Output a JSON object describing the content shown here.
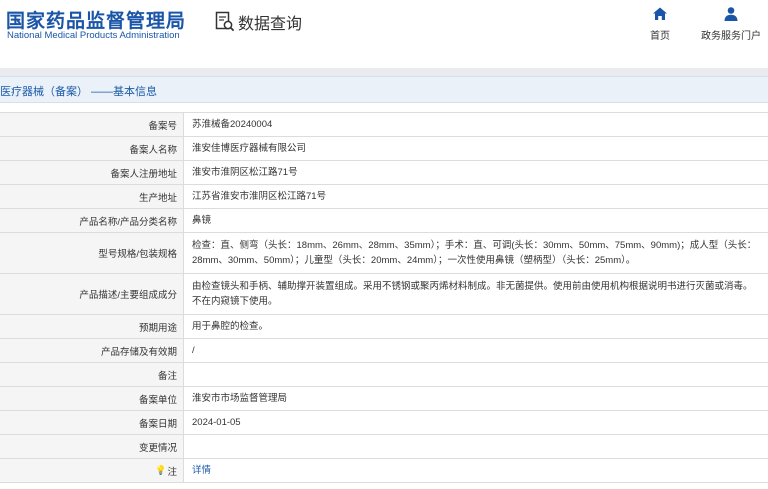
{
  "header": {
    "logo_cn": "国家药品监督管理局",
    "logo_en": "National Medical Products Administration",
    "query_title": "数据查询",
    "nav": [
      {
        "label": "首页",
        "icon": "home-icon"
      },
      {
        "label": "政务服务门户",
        "icon": "user-icon"
      }
    ]
  },
  "section": {
    "title": "医疗器械（备案） ——基本信息"
  },
  "rows": [
    {
      "label": "备案号",
      "value": "苏淮械备20240004"
    },
    {
      "label": "备案人名称",
      "value": "淮安佳博医疗器械有限公司"
    },
    {
      "label": "备案人注册地址",
      "value": "淮安市淮阴区松江路71号"
    },
    {
      "label": "生产地址",
      "value": "江苏省淮安市淮阴区松江路71号"
    },
    {
      "label": "产品名称/产品分类名称",
      "value": "鼻镜"
    },
    {
      "label": "型号规格/包装规格",
      "value": "检查：直、侧弯（头长：18mm、26mm、28mm、35mm）；手术：直、可调(头长：30mm、50mm、75mm、90mm)；成人型（头长：28mm、30mm、50mm）；儿童型（头长：20mm、24mm）；一次性使用鼻镜（塑柄型）（头长：25mm）。"
    },
    {
      "label": "产品描述/主要组成成分",
      "value": "由检查镜头和手柄、辅助撑开装置组成。采用不锈钢或聚丙烯材料制成。非无菌提供。使用前由使用机构根据说明书进行灭菌或消毒。不在内窥镜下使用。"
    },
    {
      "label": "预期用途",
      "value": "用于鼻腔的检查。"
    },
    {
      "label": "产品存储及有效期",
      "value": "/"
    },
    {
      "label": "备注",
      "value": ""
    },
    {
      "label": "备案单位",
      "value": "淮安市市场监督管理局"
    },
    {
      "label": "备案日期",
      "value": "2024-01-05"
    },
    {
      "label": "变更情况",
      "value": ""
    },
    {
      "label": "注",
      "value": "详情"
    }
  ],
  "colors": {
    "brand": "#1a55a8",
    "section_bg": "#eaf1f9",
    "label_bg": "#f5f5f5",
    "link": "#1c5ba7"
  }
}
